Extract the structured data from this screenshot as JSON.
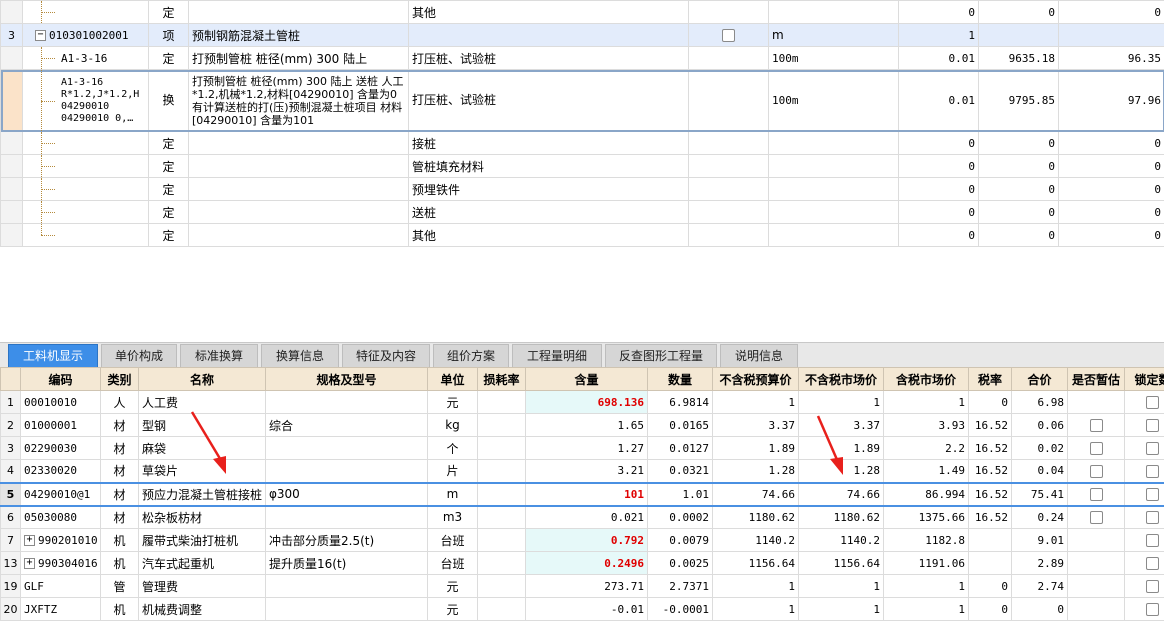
{
  "top_table": {
    "rows": [
      {
        "rn": "",
        "code": "",
        "type": "定",
        "name": "",
        "desc": "其他",
        "unit": "",
        "qty": "0",
        "price": "0",
        "total": "0"
      },
      {
        "rn": "3",
        "code": "010301002001",
        "type": "项",
        "name": "预制钢筋混凝土管桩",
        "desc": "",
        "unit": "m",
        "qty": "1",
        "price": "",
        "total": ""
      },
      {
        "rn": "",
        "code": "A1-3-16",
        "type": "定",
        "name": "打预制管桩 桩径(mm) 300 陆上",
        "desc": "打压桩、试验桩",
        "unit": "100m",
        "qty": "0.01",
        "price": "9635.18",
        "total": "96.35"
      },
      {
        "rn": "",
        "code": "A1-3-16\nR*1.2,J*1.2,H\n04290010\n04290010 0,…",
        "type": "换",
        "name": "打预制管桩 桩径(mm) 300 陆上  送桩 人工*1.2,机械*1.2,材料[04290010] 含量为0  有计算送桩的打(压)预制混凝土桩项目 材料[04290010] 含量为101",
        "desc": "打压桩、试验桩",
        "unit": "100m",
        "qty": "0.01",
        "price": "9795.85",
        "total": "97.96"
      },
      {
        "rn": "",
        "code": "",
        "type": "定",
        "name": "",
        "desc": "接桩",
        "unit": "",
        "qty": "0",
        "price": "0",
        "total": "0"
      },
      {
        "rn": "",
        "code": "",
        "type": "定",
        "name": "",
        "desc": "管桩填充材料",
        "unit": "",
        "qty": "0",
        "price": "0",
        "total": "0"
      },
      {
        "rn": "",
        "code": "",
        "type": "定",
        "name": "",
        "desc": "预埋铁件",
        "unit": "",
        "qty": "0",
        "price": "0",
        "total": "0"
      },
      {
        "rn": "",
        "code": "",
        "type": "定",
        "name": "",
        "desc": "送桩",
        "unit": "",
        "qty": "0",
        "price": "0",
        "total": "0"
      },
      {
        "rn": "",
        "code": "",
        "type": "定",
        "name": "",
        "desc": "其他",
        "unit": "",
        "qty": "0",
        "price": "0",
        "total": "0"
      }
    ]
  },
  "tabs": [
    "工料机显示",
    "单价构成",
    "标准换算",
    "换算信息",
    "特征及内容",
    "组价方案",
    "工程量明细",
    "反查图形工程量",
    "说明信息"
  ],
  "bottom_table": {
    "headers": [
      "",
      "编码",
      "类别",
      "名称",
      "规格及型号",
      "单位",
      "损耗率",
      "含量",
      "数量",
      "不含税预算价",
      "不含税市场价",
      "含税市场价",
      "税率",
      "合价",
      "是否暂估",
      "锁定数"
    ],
    "rows": [
      {
        "rn": "1",
        "code": "00010010",
        "cat": "人",
        "name": "人工费",
        "spec": "",
        "unit": "元",
        "loss": "",
        "content": "698.136",
        "qty": "6.9814",
        "p1": "1",
        "p2": "1",
        "p3": "1",
        "tax": "0",
        "total": "6.98",
        "est": false,
        "lock": true
      },
      {
        "rn": "2",
        "code": "01000001",
        "cat": "材",
        "name": "型钢",
        "spec": "综合",
        "unit": "kg",
        "loss": "",
        "content": "1.65",
        "qty": "0.0165",
        "p1": "3.37",
        "p2": "3.37",
        "p3": "3.93",
        "tax": "16.52",
        "total": "0.06",
        "est": true,
        "lock": true
      },
      {
        "rn": "3",
        "code": "02290030",
        "cat": "材",
        "name": "麻袋",
        "spec": "",
        "unit": "个",
        "loss": "",
        "content": "1.27",
        "qty": "0.0127",
        "p1": "1.89",
        "p2": "1.89",
        "p3": "2.2",
        "tax": "16.52",
        "total": "0.02",
        "est": true,
        "lock": true
      },
      {
        "rn": "4",
        "code": "02330020",
        "cat": "材",
        "name": "草袋片",
        "spec": "",
        "unit": "片",
        "loss": "",
        "content": "3.21",
        "qty": "0.0321",
        "p1": "1.28",
        "p2": "1.28",
        "p3": "1.49",
        "tax": "16.52",
        "total": "0.04",
        "est": true,
        "lock": true
      },
      {
        "rn": "5",
        "code": "04290010@1",
        "cat": "材",
        "name": "预应力混凝土管桩接桩",
        "spec": "φ300",
        "unit": "m",
        "loss": "",
        "content": "101",
        "qty": "1.01",
        "p1": "74.66",
        "p2": "74.66",
        "p3": "86.994",
        "tax": "16.52",
        "total": "75.41",
        "est": true,
        "lock": true
      },
      {
        "rn": "6",
        "code": "05030080",
        "cat": "材",
        "name": "松杂板枋材",
        "spec": "",
        "unit": "m3",
        "loss": "",
        "content": "0.021",
        "qty": "0.0002",
        "p1": "1180.62",
        "p2": "1180.62",
        "p3": "1375.66",
        "tax": "16.52",
        "total": "0.24",
        "est": true,
        "lock": true
      },
      {
        "rn": "7",
        "code": "990201010",
        "cat": "机",
        "name": "履带式柴油打桩机",
        "spec": "冲击部分质量2.5(t)",
        "unit": "台班",
        "loss": "",
        "content": "0.792",
        "qty": "0.0079",
        "p1": "1140.2",
        "p2": "1140.2",
        "p3": "1182.8",
        "tax": "",
        "total": "9.01",
        "est": false,
        "lock": true
      },
      {
        "rn": "13",
        "code": "990304016",
        "cat": "机",
        "name": "汽车式起重机",
        "spec": "提升质量16(t)",
        "unit": "台班",
        "loss": "",
        "content": "0.2496",
        "qty": "0.0025",
        "p1": "1156.64",
        "p2": "1156.64",
        "p3": "1191.06",
        "tax": "",
        "total": "2.89",
        "est": false,
        "lock": true
      },
      {
        "rn": "19",
        "code": "GLF",
        "cat": "管",
        "name": "管理费",
        "spec": "",
        "unit": "元",
        "loss": "",
        "content": "273.71",
        "qty": "2.7371",
        "p1": "1",
        "p2": "1",
        "p3": "1",
        "tax": "0",
        "total": "2.74",
        "est": false,
        "lock": true
      },
      {
        "rn": "20",
        "code": "JXFTZ",
        "cat": "机",
        "name": "机械费调整",
        "spec": "",
        "unit": "元",
        "loss": "",
        "content": "-0.01",
        "qty": "-0.0001",
        "p1": "1",
        "p2": "1",
        "p3": "1",
        "tax": "0",
        "total": "0",
        "est": false,
        "lock": true
      }
    ]
  },
  "colors": {
    "tab_active": "#3d8ee8",
    "header_bg": "#f4e8d4",
    "content_highlight": "#e6f9f9",
    "red_value": "#e00000",
    "annotation_arrow": "#e8201c"
  }
}
